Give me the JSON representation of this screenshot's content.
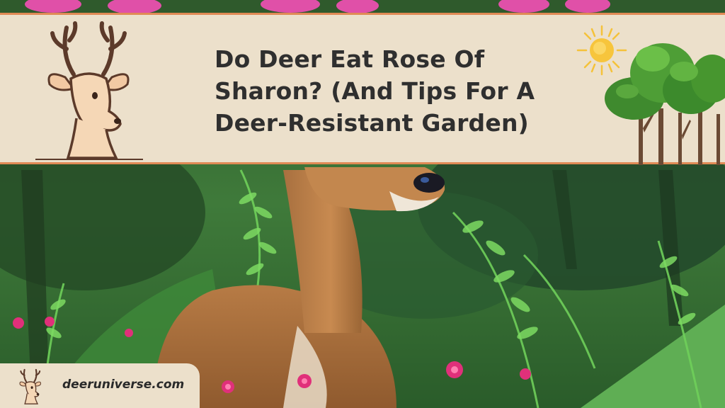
{
  "article": {
    "title": "Do Deer Eat Rose Of Sharon? (And Tips For A Deer-Resistant Garden)"
  },
  "branding": {
    "site_url": "deeruniverse.com",
    "logo_icon": "deer-head-icon"
  },
  "decor": {
    "sun_icon": "sun-icon",
    "trees_icon": "trees-icon"
  },
  "colors": {
    "banner_background": "#ece0cb",
    "banner_border": "#e08a55",
    "title_text": "#2f2f2f",
    "forest_green": "#2e6b30",
    "flower_pink": "#e0307a"
  }
}
